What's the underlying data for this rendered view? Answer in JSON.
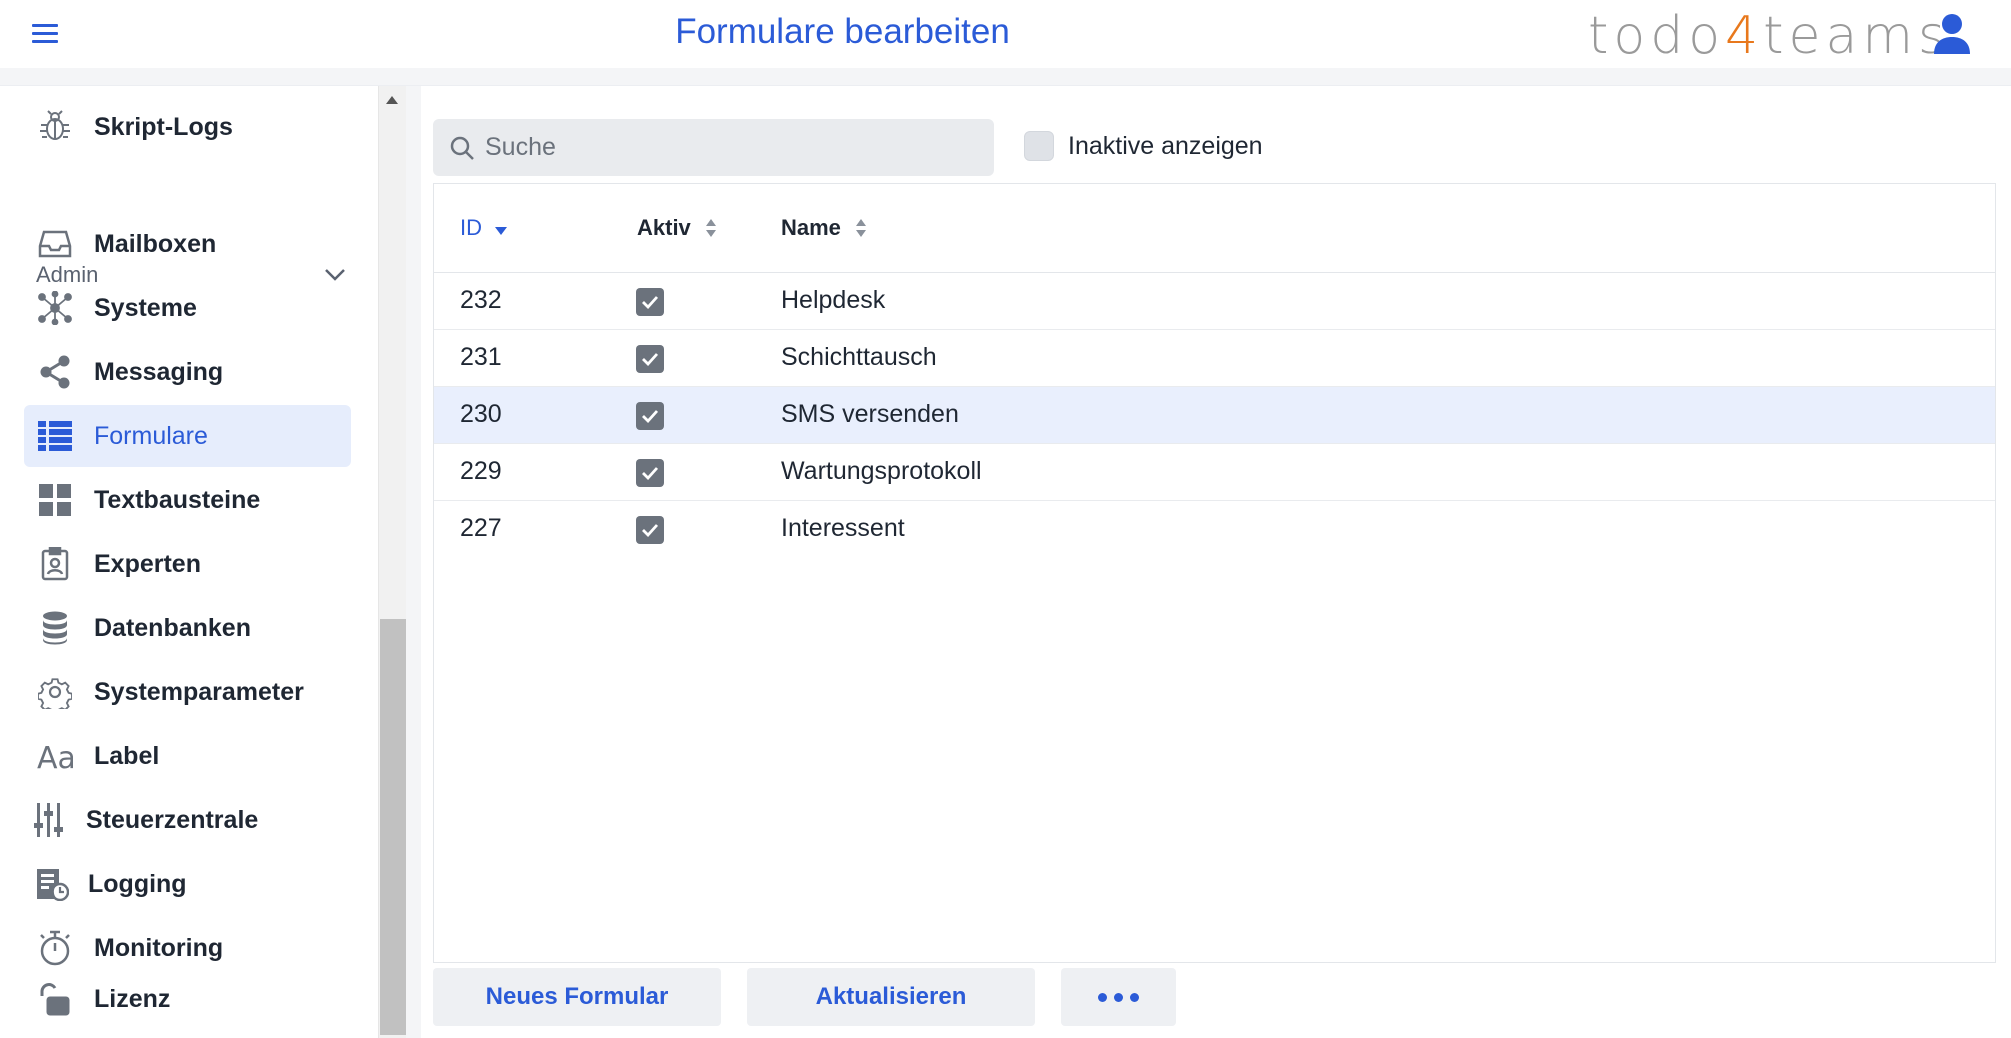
{
  "header": {
    "title": "Formulare bearbeiten",
    "logo": {
      "prefix": "todo",
      "digit": "4",
      "suffix": "teams"
    }
  },
  "sidebar": {
    "items": [
      {
        "label": "Skript-Logs",
        "icon": "bug-icon"
      },
      {
        "label": "Mailboxen",
        "icon": "inbox-icon"
      },
      {
        "label": "Systeme",
        "icon": "network-icon"
      },
      {
        "label": "Messaging",
        "icon": "share-icon"
      },
      {
        "label": "Formulare",
        "icon": "list-icon",
        "active": true
      },
      {
        "label": "Textbausteine",
        "icon": "grid-icon"
      },
      {
        "label": "Experten",
        "icon": "badge-icon"
      },
      {
        "label": "Datenbanken",
        "icon": "database-icon"
      },
      {
        "label": "Systemparameter",
        "icon": "gear-icon"
      },
      {
        "label": "Label",
        "icon": "font-icon"
      },
      {
        "label": "Steuerzentrale",
        "icon": "sliders-icon"
      },
      {
        "label": "Logging",
        "icon": "log-icon"
      },
      {
        "label": "Monitoring",
        "icon": "stopwatch-icon"
      },
      {
        "label": "Lizenz",
        "icon": "unlock-icon"
      }
    ],
    "section": {
      "label": "Admin"
    }
  },
  "main": {
    "search": {
      "placeholder": "Suche"
    },
    "inactive_toggle": {
      "label": "Inaktive anzeigen",
      "checked": false
    },
    "table": {
      "columns": [
        "ID",
        "Aktiv",
        "Name"
      ],
      "sorted_by": "ID",
      "rows": [
        {
          "id": "232",
          "active": true,
          "name": "Helpdesk"
        },
        {
          "id": "231",
          "active": true,
          "name": "Schichttausch"
        },
        {
          "id": "230",
          "active": true,
          "name": "SMS versenden",
          "selected": true
        },
        {
          "id": "229",
          "active": true,
          "name": "Wartungsprotokoll"
        },
        {
          "id": "227",
          "active": true,
          "name": "Interessent"
        }
      ]
    },
    "buttons": {
      "new": "Neues Formular",
      "refresh": "Aktualisieren"
    }
  },
  "colors": {
    "accent": "#2b5bd7",
    "logo_digit": "#e8781c",
    "selected_row": "#e9effd"
  }
}
